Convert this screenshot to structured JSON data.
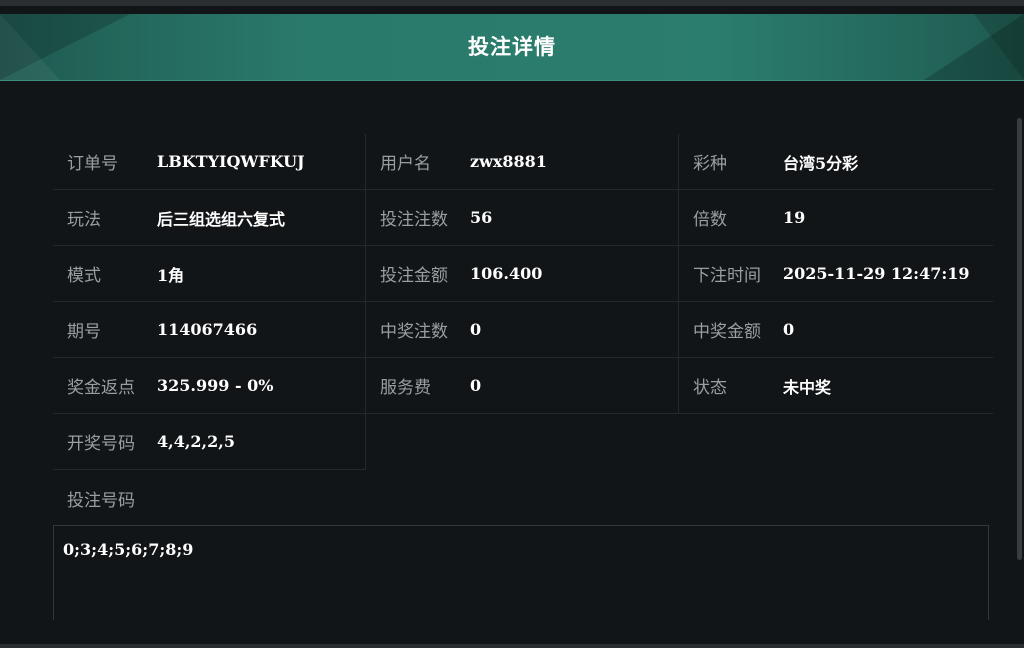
{
  "header": {
    "title": "投注详情"
  },
  "fields": [
    [
      {
        "label": "订单号",
        "value": "LBKTYIQWFKUJ"
      },
      {
        "label": "用户名",
        "value": "zwx8881"
      },
      {
        "label": "彩种",
        "value": "台湾5分彩"
      }
    ],
    [
      {
        "label": "玩法",
        "value": "后三组选组六复式"
      },
      {
        "label": "投注注数",
        "value": "56"
      },
      {
        "label": "倍数",
        "value": "19"
      }
    ],
    [
      {
        "label": "模式",
        "value": "1角"
      },
      {
        "label": "投注金额",
        "value": "106.400"
      },
      {
        "label": "下注时间",
        "value": "2025-11-29 12:47:19"
      }
    ],
    [
      {
        "label": "期号",
        "value": "114067466"
      },
      {
        "label": "中奖注数",
        "value": "0"
      },
      {
        "label": "中奖金额",
        "value": "0"
      }
    ],
    [
      {
        "label": "奖金返点",
        "value": "325.999 - 0%"
      },
      {
        "label": "服务费",
        "value": "0"
      },
      {
        "label": "状态",
        "value": "未中奖"
      }
    ],
    [
      {
        "label": "开奖号码",
        "value": "4,4,2,2,5"
      }
    ]
  ],
  "bet_numbers": {
    "label": "投注号码",
    "value": "0;3;4;5;6;7;8;9"
  }
}
